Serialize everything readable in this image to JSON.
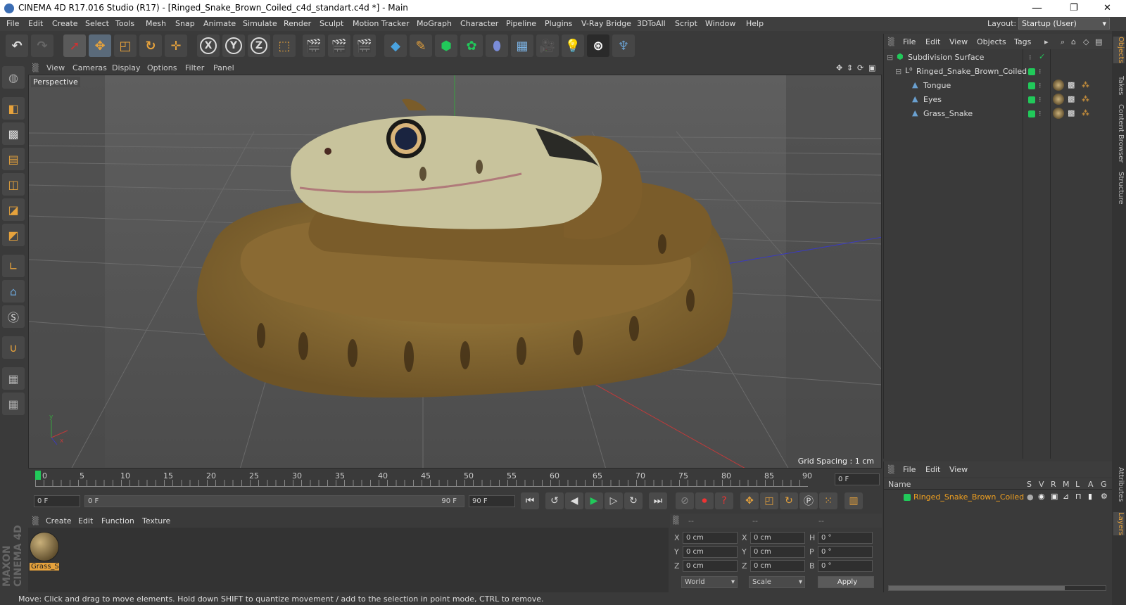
{
  "window": {
    "title": "CINEMA 4D R17.016 Studio (R17) - [Ringed_Snake_Brown_Coiled_c4d_standart.c4d *] - Main",
    "minimize": "—",
    "maximize": "❐",
    "close": "✕"
  },
  "menubar": {
    "items": [
      "File",
      "Edit",
      "Create",
      "Select",
      "Tools",
      "Mesh",
      "Snap",
      "Animate",
      "Simulate",
      "Render",
      "Sculpt",
      "Motion Tracker",
      "MoGraph",
      "Character",
      "Pipeline",
      "Plugins",
      "V-Ray Bridge",
      "3DToAll",
      "Script",
      "Window",
      "Help"
    ],
    "layout_label": "Layout:",
    "layout_value": "Startup (User)"
  },
  "toolbar": {
    "x_label": "X",
    "y_label": "Y",
    "z_label": "Z"
  },
  "viewport": {
    "menu": [
      "View",
      "Cameras",
      "Display",
      "Options",
      "Filter",
      "Panel"
    ],
    "label": "Perspective",
    "grid_spacing": "Grid Spacing : 1 cm"
  },
  "timeline": {
    "ticks": [
      "0",
      "5",
      "10",
      "15",
      "20",
      "25",
      "30",
      "35",
      "40",
      "45",
      "50",
      "55",
      "60",
      "65",
      "70",
      "75",
      "80",
      "85",
      "90"
    ],
    "current_frame": "0 F"
  },
  "transport": {
    "start_field": "0 F",
    "range_start": "0 F",
    "range_end": "90 F",
    "end_field": "90 F"
  },
  "material_manager": {
    "menu": [
      "Create",
      "Edit",
      "Function",
      "Texture"
    ],
    "material_name": "Grass_S"
  },
  "attributes": {
    "headers": [
      "--",
      "--",
      "--"
    ],
    "rows": [
      {
        "a": "X",
        "av": "0 cm",
        "b": "X",
        "bv": "0 cm",
        "c": "H",
        "cv": "0 °"
      },
      {
        "a": "Y",
        "av": "0 cm",
        "b": "Y",
        "bv": "0 cm",
        "c": "P",
        "cv": "0 °"
      },
      {
        "a": "Z",
        "av": "0 cm",
        "b": "Z",
        "bv": "0 cm",
        "c": "B",
        "cv": "0 °"
      }
    ],
    "coord_mode": "World",
    "scale_mode": "Scale",
    "apply": "Apply"
  },
  "status": "Move: Click and drag to move elements. Hold down SHIFT to quantize movement / add to the selection in point mode, CTRL to remove.",
  "objects_panel": {
    "menu": [
      "File",
      "Edit",
      "View",
      "Objects",
      "Tags"
    ],
    "items": [
      {
        "name": "Subdivision Surface"
      },
      {
        "name": "Ringed_Snake_Brown_Coiled"
      },
      {
        "name": "Tongue"
      },
      {
        "name": "Eyes"
      },
      {
        "name": "Grass_Snake"
      }
    ]
  },
  "layers_panel": {
    "menu": [
      "File",
      "Edit",
      "View"
    ],
    "col_name": "Name",
    "cols": [
      "S",
      "V",
      "R",
      "M",
      "L",
      "A",
      "G"
    ],
    "layer_name": "Ringed_Snake_Brown_Coiled"
  },
  "side_tabs": [
    "Objects",
    "Takes",
    "Content Browser",
    "Structure",
    "Attributes",
    "Layers"
  ],
  "brand": "MAXON CINEMA 4D",
  "colors": {
    "accent": "#e6a23c",
    "green": "#21c95a",
    "layer_name": "#f0a020"
  }
}
